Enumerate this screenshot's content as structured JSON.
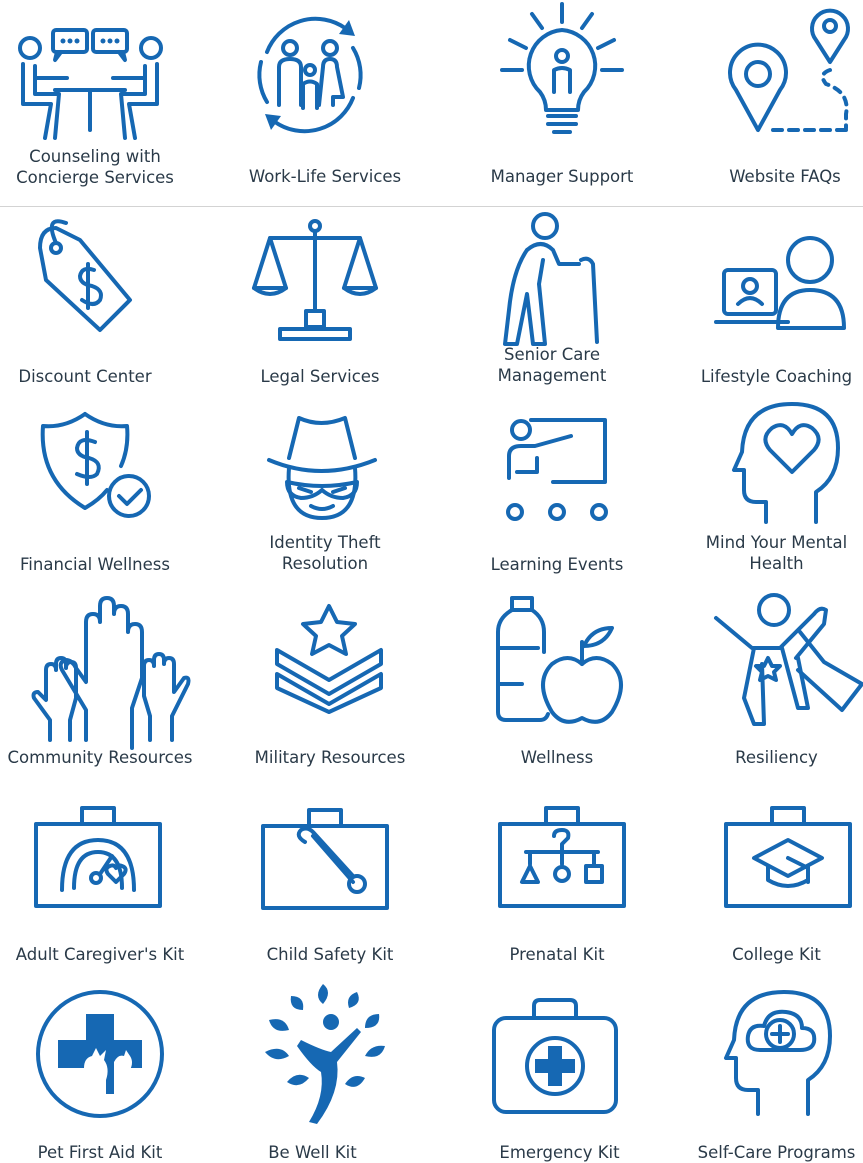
{
  "theme": {
    "icon_color": "#1668b3",
    "text_color": "#2a3a48"
  },
  "tiles": [
    {
      "label": "Counseling with Concierge Services",
      "lines": [
        "Counseling with",
        "Concierge Services"
      ],
      "icon": "counseling-icon"
    },
    {
      "label": "Work-Life Services",
      "lines": [
        "Work-Life Services"
      ],
      "icon": "family-cycle-icon"
    },
    {
      "label": "Manager Support",
      "lines": [
        "Manager Support"
      ],
      "icon": "lightbulb-person-icon"
    },
    {
      "label": "Website FAQs",
      "lines": [
        "Website FAQs"
      ],
      "icon": "map-pins-icon"
    },
    {
      "label": "Discount Center",
      "lines": [
        "Discount Center"
      ],
      "icon": "price-tag-icon"
    },
    {
      "label": "Legal Services",
      "lines": [
        "Legal Services"
      ],
      "icon": "scales-icon"
    },
    {
      "label": "Senior Care Management",
      "lines": [
        "Senior Care",
        "Management"
      ],
      "icon": "senior-cane-icon"
    },
    {
      "label": "Lifestyle Coaching",
      "lines": [
        "Lifestyle Coaching"
      ],
      "icon": "video-coach-icon"
    },
    {
      "label": "Financial Wellness",
      "lines": [
        "Financial Wellness"
      ],
      "icon": "shield-dollar-icon"
    },
    {
      "label": "Identity Theft Resolution",
      "lines": [
        "Identity Theft",
        "Resolution"
      ],
      "icon": "masked-spy-icon"
    },
    {
      "label": "Learning Events",
      "lines": [
        "Learning Events"
      ],
      "icon": "presentation-icon"
    },
    {
      "label": "Mind Your Mental Health",
      "lines": [
        "Mind Your Mental",
        "Health"
      ],
      "icon": "head-heart-icon"
    },
    {
      "label": "Community Resources",
      "lines": [
        "Community Resources"
      ],
      "icon": "raised-hands-icon"
    },
    {
      "label": "Military Resources",
      "lines": [
        "Military Resources"
      ],
      "icon": "chevron-star-icon"
    },
    {
      "label": "Wellness",
      "lines": [
        "Wellness"
      ],
      "icon": "water-apple-icon"
    },
    {
      "label": "Resiliency",
      "lines": [
        "Resiliency"
      ],
      "icon": "superhero-icon"
    },
    {
      "label": "Adult Caregiver's Kit",
      "lines": [
        "Adult Caregiver's Kit"
      ],
      "icon": "kit-gauge-icon"
    },
    {
      "label": "Child Safety Kit",
      "lines": [
        "Child Safety Kit"
      ],
      "icon": "kit-safety-pin-icon"
    },
    {
      "label": "Prenatal Kit",
      "lines": [
        "Prenatal Kit"
      ],
      "icon": "kit-baby-mobile-icon"
    },
    {
      "label": "College Kit",
      "lines": [
        "College Kit"
      ],
      "icon": "kit-grad-cap-icon"
    },
    {
      "label": "Pet First Aid Kit",
      "lines": [
        "Pet First Aid Kit"
      ],
      "icon": "pet-cross-icon"
    },
    {
      "label": "Be Well Kit",
      "lines": [
        "Be Well Kit"
      ],
      "icon": "leaf-person-icon"
    },
    {
      "label": "Emergency Kit",
      "lines": [
        "Emergency Kit"
      ],
      "icon": "first-aid-kit-icon"
    },
    {
      "label": "Self-Care Programs",
      "lines": [
        "Self-Care Programs"
      ],
      "icon": "head-cloud-plus-icon"
    }
  ]
}
